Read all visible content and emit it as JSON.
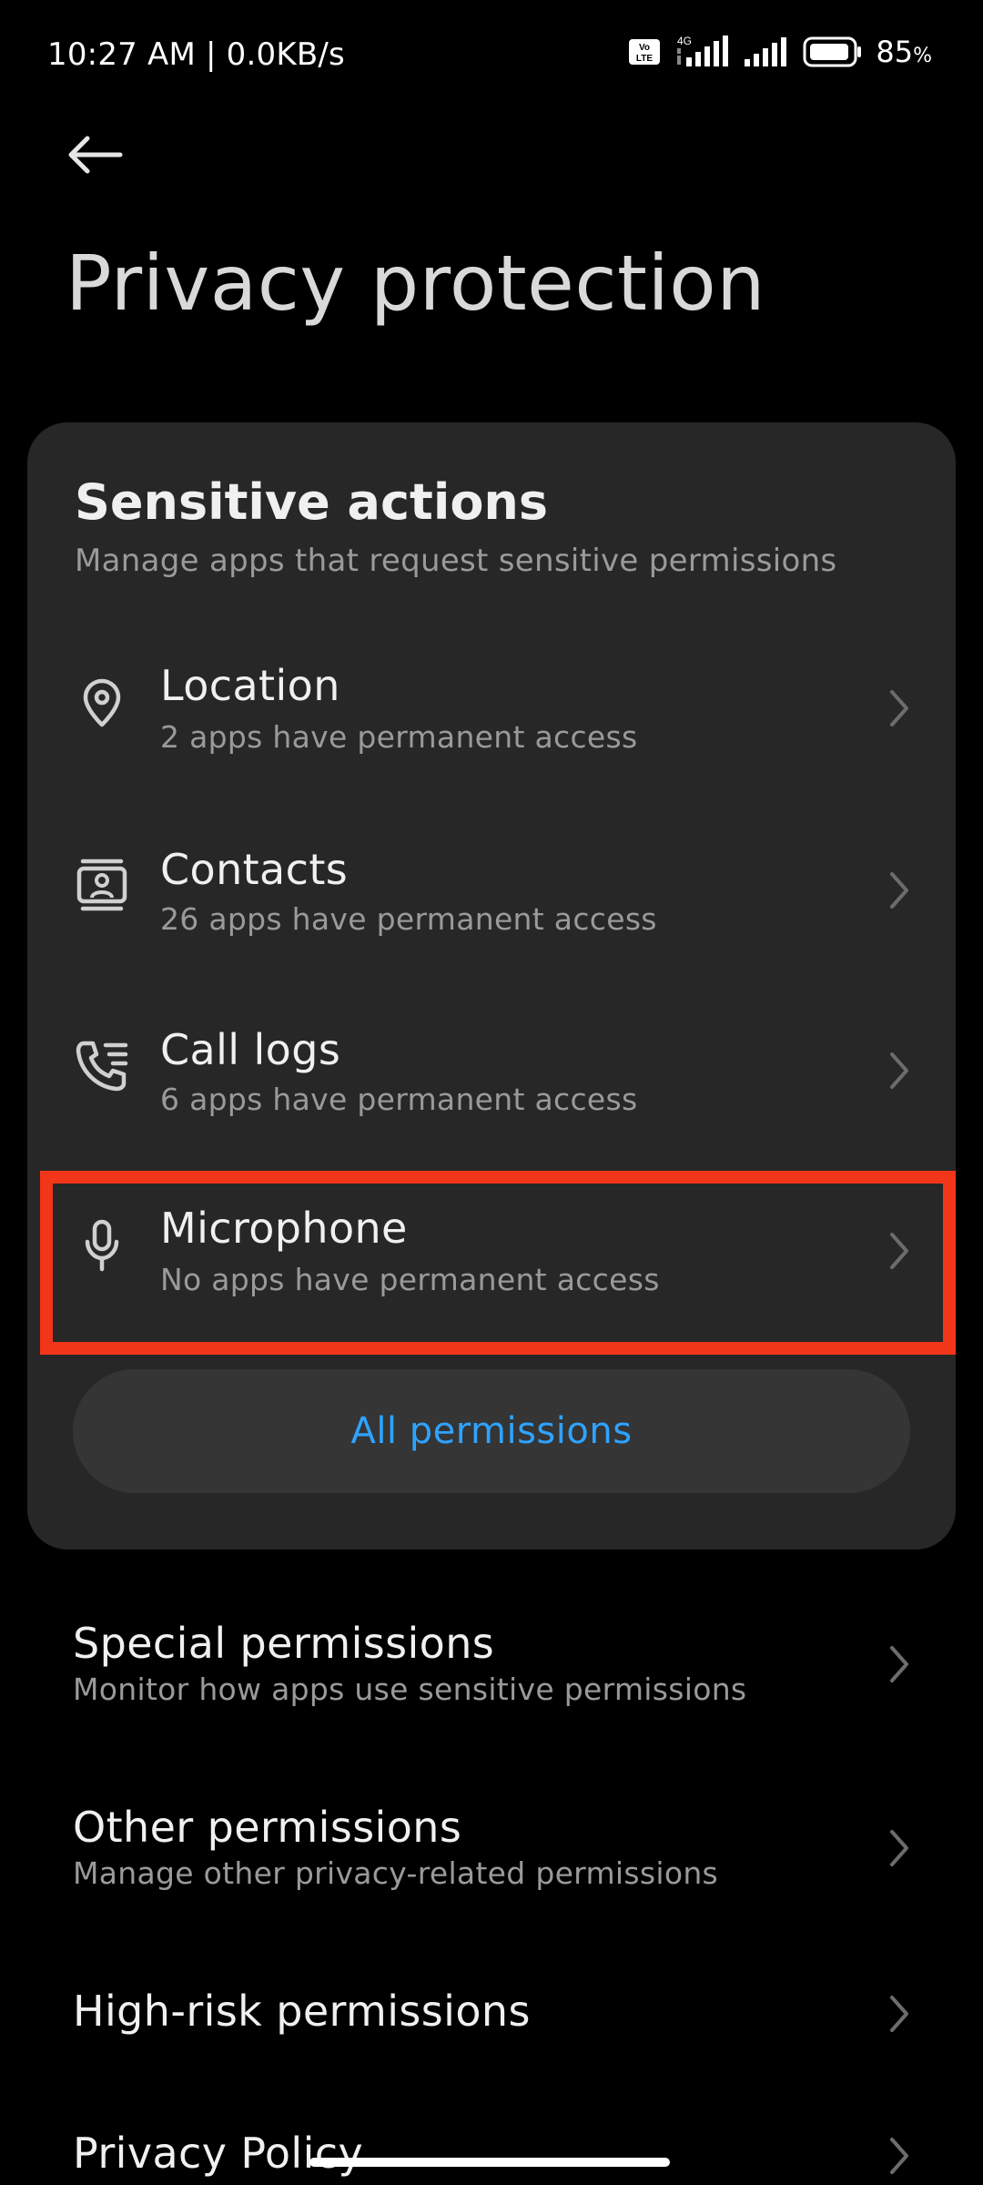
{
  "status_bar": {
    "time_speed": "10:27 AM | 0.0KB/s",
    "volte_label": "Vo LTE",
    "network_label": "4G",
    "battery_value": "85",
    "battery_unit": "%"
  },
  "header": {
    "back_icon": "arrow-left-icon",
    "title": "Privacy protection"
  },
  "sensitive_actions": {
    "title": "Sensitive actions",
    "subtitle": "Manage apps that request sensitive permissions",
    "items": [
      {
        "label": "Location",
        "desc": "2 apps have permanent access",
        "icon": "location-pin-icon"
      },
      {
        "label": "Contacts",
        "desc": "26 apps have permanent access",
        "icon": "contacts-icon"
      },
      {
        "label": "Call logs",
        "desc": "6 apps have permanent access",
        "icon": "call-log-icon"
      },
      {
        "label": "Microphone",
        "desc": "No apps have permanent access",
        "icon": "microphone-icon"
      }
    ],
    "all_permissions_label": "All permissions"
  },
  "other_list": [
    {
      "label": "Special permissions",
      "desc": "Monitor how apps use sensitive permissions"
    },
    {
      "label": "Other permissions",
      "desc": "Manage other privacy-related permissions"
    },
    {
      "label": "High-risk permissions",
      "desc": ""
    },
    {
      "label": "Privacy Policy",
      "desc": ""
    }
  ],
  "colors": {
    "background": "#000000",
    "card": "#272727",
    "accent_blue": "#2ea3ff",
    "highlight_red": "#f2361a"
  }
}
